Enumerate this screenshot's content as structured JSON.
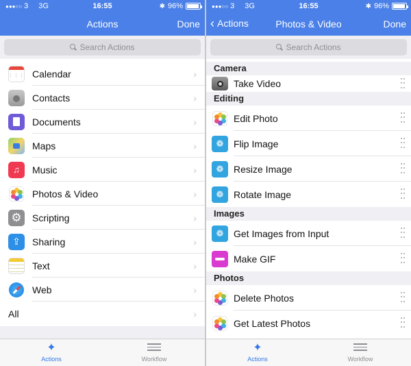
{
  "left": {
    "status": {
      "carrier": "3",
      "network": "3G",
      "time": "16:55",
      "battery_text": "96%",
      "battery_level": 0.96
    },
    "nav": {
      "title": "Actions",
      "done": "Done"
    },
    "search": {
      "placeholder": "Search Actions"
    },
    "categories": [
      {
        "label": "Calendar",
        "icon": "calendar-icon"
      },
      {
        "label": "Contacts",
        "icon": "contacts-icon"
      },
      {
        "label": "Documents",
        "icon": "documents-icon"
      },
      {
        "label": "Maps",
        "icon": "maps-icon"
      },
      {
        "label": "Music",
        "icon": "music-icon"
      },
      {
        "label": "Photos & Video",
        "icon": "photos-icon"
      },
      {
        "label": "Scripting",
        "icon": "gear-icon"
      },
      {
        "label": "Sharing",
        "icon": "share-icon"
      },
      {
        "label": "Text",
        "icon": "notes-icon"
      },
      {
        "label": "Web",
        "icon": "safari-icon"
      }
    ],
    "all_label": "All",
    "tabs": {
      "actions": "Actions",
      "workflow": "Workflow"
    }
  },
  "right": {
    "status": {
      "carrier": "3",
      "network": "3G",
      "time": "16:55",
      "battery_text": "96%",
      "battery_level": 0.96
    },
    "nav": {
      "back": "Actions",
      "title": "Photos & Video",
      "done": "Done"
    },
    "search": {
      "placeholder": "Search Actions"
    },
    "sections": [
      {
        "title": "Camera",
        "items": [
          {
            "label": "Take Video",
            "icon": "camera-icon"
          }
        ]
      },
      {
        "title": "Editing",
        "items": [
          {
            "label": "Edit Photo",
            "icon": "photos-icon"
          },
          {
            "label": "Flip Image",
            "icon": "image-atom-icon"
          },
          {
            "label": "Resize Image",
            "icon": "image-atom-icon"
          },
          {
            "label": "Rotate Image",
            "icon": "image-atom-icon"
          }
        ]
      },
      {
        "title": "Images",
        "items": [
          {
            "label": "Get Images from Input",
            "icon": "image-atom-icon"
          },
          {
            "label": "Make GIF",
            "icon": "gif-icon"
          }
        ]
      },
      {
        "title": "Photos",
        "items": [
          {
            "label": "Delete Photos",
            "icon": "photos-icon"
          },
          {
            "label": "Get Latest Photos",
            "icon": "photos-icon"
          }
        ]
      }
    ],
    "tabs": {
      "actions": "Actions",
      "workflow": "Workflow"
    }
  },
  "colors": {
    "nav_blue": "#4a80e8",
    "tab_active": "#3478e8",
    "section_bg": "#efeff4"
  }
}
